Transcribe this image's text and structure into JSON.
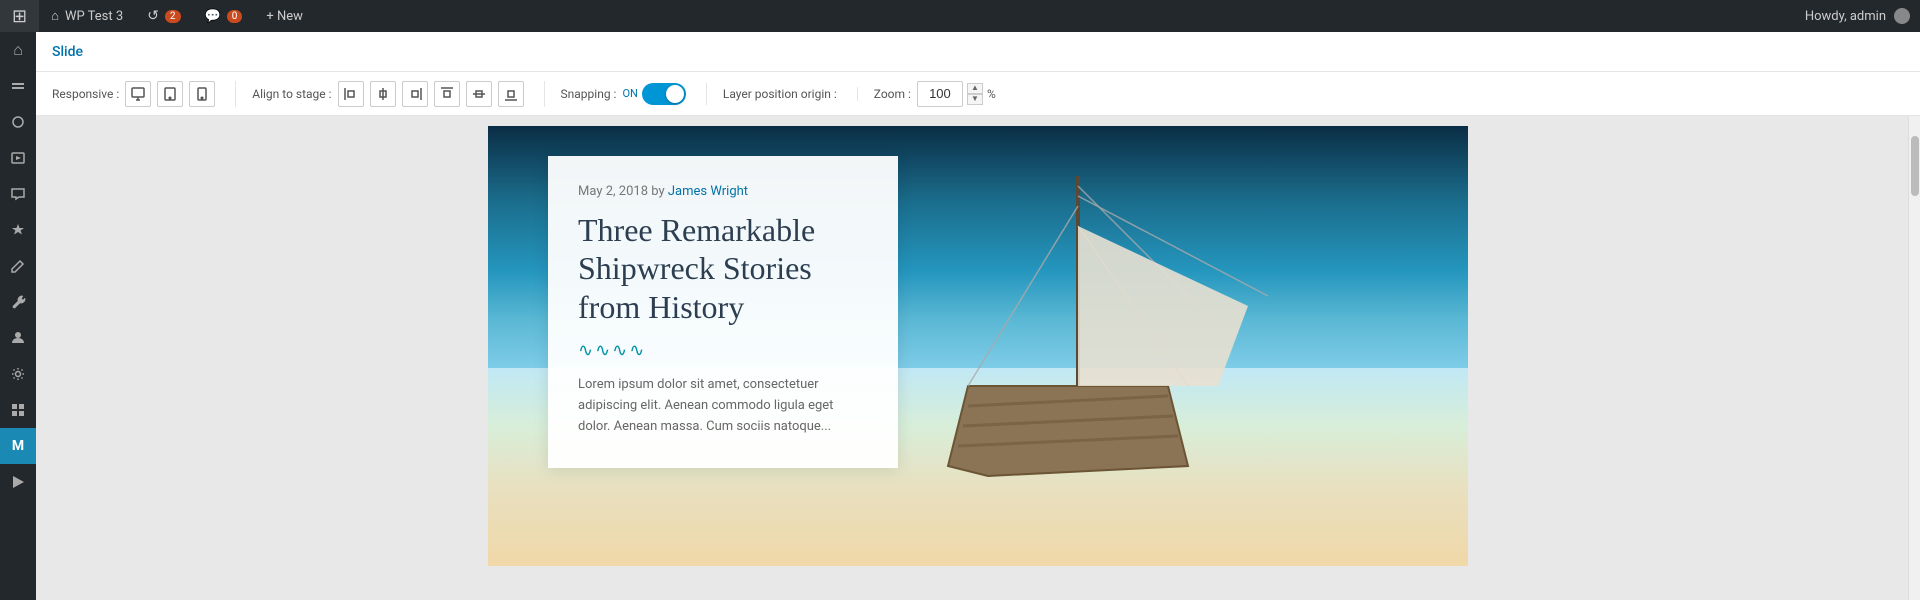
{
  "adminbar": {
    "site_name": "WP Test 3",
    "updates_count": "2",
    "comments_count": "0",
    "new_label": "+ New",
    "howdy": "Howdy, admin"
  },
  "sidebar": {
    "icons": [
      {
        "name": "home-icon",
        "symbol": "⌂",
        "active": false
      },
      {
        "name": "layers-icon",
        "symbol": "◫",
        "active": false
      },
      {
        "name": "shapes-icon",
        "symbol": "❖",
        "active": false
      },
      {
        "name": "media-icon",
        "symbol": "▣",
        "active": false
      },
      {
        "name": "comments-icon",
        "symbol": "💬",
        "active": false
      },
      {
        "name": "pin-icon",
        "symbol": "📌",
        "active": false
      },
      {
        "name": "edit-icon",
        "symbol": "✏",
        "active": false
      },
      {
        "name": "wrench-icon",
        "symbol": "🔧",
        "active": false
      },
      {
        "name": "person-icon",
        "symbol": "👤",
        "active": false
      },
      {
        "name": "settings-icon",
        "symbol": "⚙",
        "active": false
      },
      {
        "name": "grid-icon",
        "symbol": "▦",
        "active": false
      },
      {
        "name": "slider-logo-icon",
        "symbol": "M",
        "active": true
      },
      {
        "name": "play-icon",
        "symbol": "▶",
        "active": false
      }
    ]
  },
  "toolbar": {
    "slide_label": "Slide"
  },
  "controls": {
    "responsive_label": "Responsive :",
    "responsive_buttons": [
      {
        "name": "desktop-btn",
        "icon": "desktop"
      },
      {
        "name": "tablet-btn",
        "icon": "tablet"
      },
      {
        "name": "mobile-btn",
        "icon": "mobile"
      }
    ],
    "align_stage_label": "Align to stage :",
    "align_buttons": [
      {
        "name": "align-left-btn"
      },
      {
        "name": "align-center-btn"
      },
      {
        "name": "align-right-btn"
      },
      {
        "name": "align-top-btn"
      },
      {
        "name": "align-middle-btn"
      },
      {
        "name": "align-bottom-btn"
      }
    ],
    "snapping_label": "Snapping :",
    "snapping_on": "ON",
    "snapping_state": true,
    "layer_origin_label": "Layer position origin :",
    "zoom_label": "Zoom :",
    "zoom_value": "100",
    "zoom_unit": "%"
  },
  "slide": {
    "post_date": "May 2, 2018",
    "post_by": "by",
    "post_author": "James Wright",
    "post_title": "Three Remarkable Shipwreck Stories from History",
    "wave_symbol": "∿∿∿∿",
    "excerpt": "Lorem ipsum dolor sit amet, consectetuer adipiscing elit. Aenean commodo ligula eget dolor. Aenean massa. Cum sociis natoque..."
  }
}
